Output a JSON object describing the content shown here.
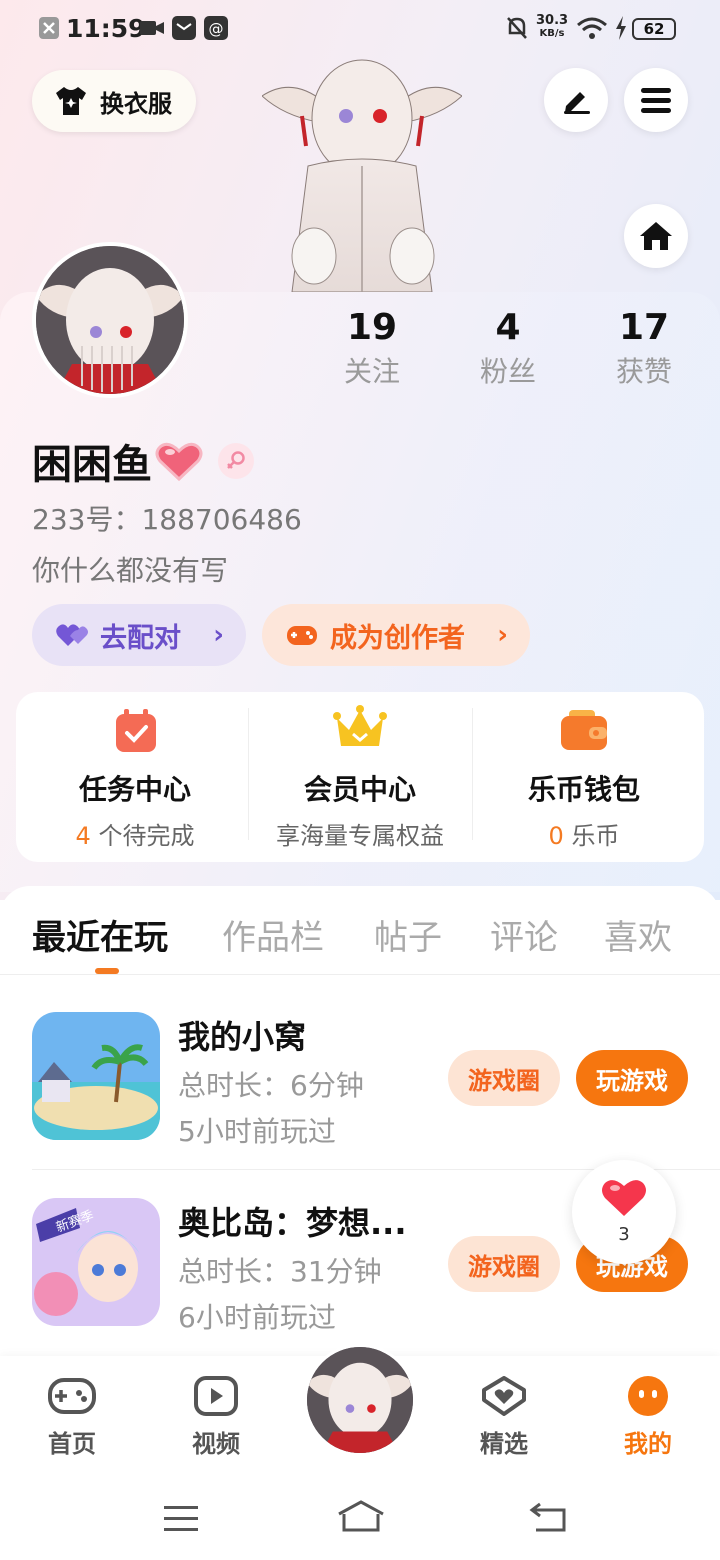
{
  "status_bar": {
    "time": "11:59",
    "network_speed": "30.3",
    "network_unit": "KB/s",
    "battery": "62"
  },
  "header": {
    "outfit_label": "换衣服"
  },
  "profile": {
    "stats": [
      {
        "value": "19",
        "label": "关注"
      },
      {
        "value": "4",
        "label": "粉丝"
      },
      {
        "value": "17",
        "label": "获赞"
      }
    ],
    "username": "困困鱼",
    "id_line": "233号：188706486",
    "bio": "你什么都没有写",
    "pair_label": "去配对",
    "creator_label": "成为创作者"
  },
  "services": [
    {
      "title": "任务中心",
      "highlight": "4",
      "sub": " 个待完成"
    },
    {
      "title": "会员中心",
      "highlight": "",
      "sub": "享海量专属权益"
    },
    {
      "title": "乐币钱包",
      "highlight": "0",
      "sub": " 乐币"
    }
  ],
  "tabs": [
    "最近在玩",
    "作品栏",
    "帖子",
    "评论",
    "喜欢"
  ],
  "games": [
    {
      "name": "我的小窝",
      "duration": "总时长：6分钟",
      "last_played": "5小时前玩过",
      "circle_label": "游戏圈",
      "play_label": "玩游戏"
    },
    {
      "name": "奥比岛：梦想...",
      "duration": "总时长：31分钟",
      "last_played": "6小时前玩过",
      "circle_label": "游戏圈",
      "play_label": "玩游戏"
    }
  ],
  "like_float": {
    "count": "3"
  },
  "bottom_nav": [
    {
      "label": "首页",
      "icon": "gamepad-icon"
    },
    {
      "label": "视频",
      "icon": "video-play-icon"
    },
    {
      "label": "精选",
      "icon": "heart-badge-icon"
    },
    {
      "label": "我的",
      "icon": "face-icon"
    }
  ],
  "colors": {
    "accent": "#f6760f",
    "pair": "#6a4fc9",
    "creator": "#f3641e"
  }
}
